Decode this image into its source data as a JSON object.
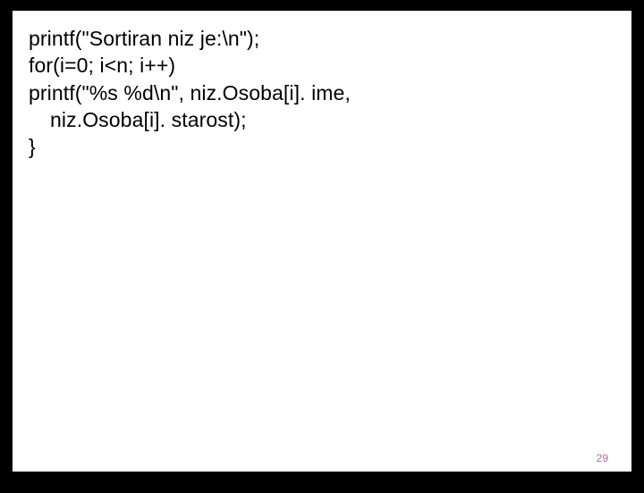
{
  "code": {
    "line1": "printf(\"Sortiran niz je:\\n\");",
    "line2": "for(i=0; i<n; i++)",
    "line3": "printf(\"%s %d\\n\", niz.Osoba[i]. ime,",
    "line4": "niz.Osoba[i]. starost);",
    "line5": "}"
  },
  "page_number": "29"
}
